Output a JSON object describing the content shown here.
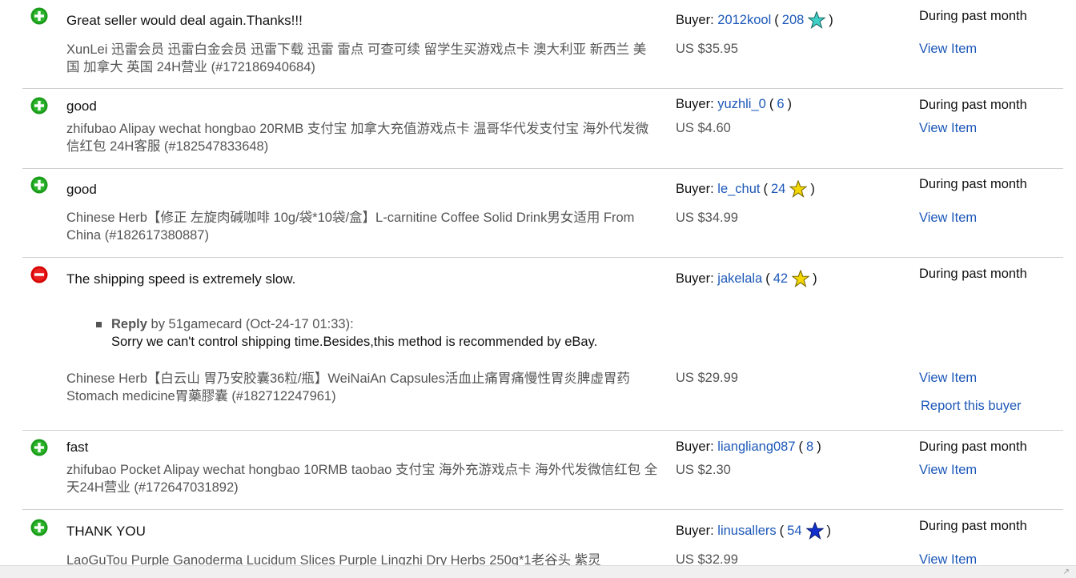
{
  "feedback": [
    {
      "type": "positive",
      "comment": "Great seller would deal again.Thanks!!!",
      "item_title": "XunLei 迅雷会员 迅雷白金会员 迅雷下载 迅雷 雷点 可查可续 留学生买游戏点卡 澳大利亚 新西兰 美国 加拿大 英国 24H营业 (#172186940684)",
      "buyer_label": "Buyer:",
      "buyer": "2012kool",
      "score": "208",
      "star": "turquoise",
      "price": "US $35.95",
      "period": "During past month",
      "view_item": "View Item"
    },
    {
      "type": "positive",
      "comment": "good",
      "item_title": "zhifubao Alipay wechat hongbao 20RMB 支付宝 加拿大充值游戏点卡 温哥华代发支付宝 海外代发微信红包 24H客服 (#182547833648)",
      "buyer_label": "Buyer:",
      "buyer": "yuzhli_0",
      "score": "6",
      "star": "",
      "price": "US $4.60",
      "period": "During past month",
      "view_item": "View Item"
    },
    {
      "type": "positive",
      "comment": "good",
      "item_title": "Chinese Herb【修正 左旋肉碱咖啡 10g/袋*10袋/盒】L-carnitine Coffee Solid Drink男女适用 From China (#182617380887)",
      "buyer_label": "Buyer:",
      "buyer": "le_chut",
      "score": "24",
      "star": "yellow",
      "price": "US $34.99",
      "period": "During past month",
      "view_item": "View Item"
    },
    {
      "type": "negative",
      "comment": "The shipping speed is extremely slow.",
      "reply_label": "Reply",
      "reply_meta": "by 51gamecard (Oct-24-17 01:33):",
      "reply_text": "Sorry we can't control shipping time.Besides,this method is recommended by eBay.",
      "item_title": "Chinese Herb【白云山 胃乃安胶囊36粒/瓶】WeiNaiAn Capsules活血止痛胃痛慢性胃炎脾虚胃药Stomach medicine胃藥膠囊 (#182712247961)",
      "buyer_label": "Buyer:",
      "buyer": "jakelala",
      "score": "42",
      "star": "yellow",
      "price": "US $29.99",
      "period": "During past month",
      "view_item": "View Item",
      "report": "Report this buyer"
    },
    {
      "type": "positive",
      "comment": "fast",
      "item_title": "zhifubao Pocket Alipay wechat hongbao 10RMB taobao 支付宝 海外充游戏点卡 海外代发微信红包 全天24H营业 (#172647031892)",
      "buyer_label": "Buyer:",
      "buyer": "liangliang087",
      "score": "8",
      "star": "",
      "price": "US $2.30",
      "period": "During past month",
      "view_item": "View Item"
    },
    {
      "type": "positive",
      "comment": "THANK YOU",
      "item_title": "LaoGuTou Purple Ganoderma Lucidum Slices Purple Lingzhi Dry Herbs 250g*1老谷头 紫灵",
      "buyer_label": "Buyer:",
      "buyer": "linusallers",
      "score": "54",
      "star": "blue",
      "price": "US $32.99",
      "period": "During past month",
      "view_item": "View Item"
    }
  ],
  "colors": {
    "positive": "#1a9a1a",
    "negative": "#d40000",
    "link": "#1d58b8",
    "star_turquoise": "#40d0c8",
    "star_yellow": "#f5d800",
    "star_blue": "#1030d0"
  }
}
